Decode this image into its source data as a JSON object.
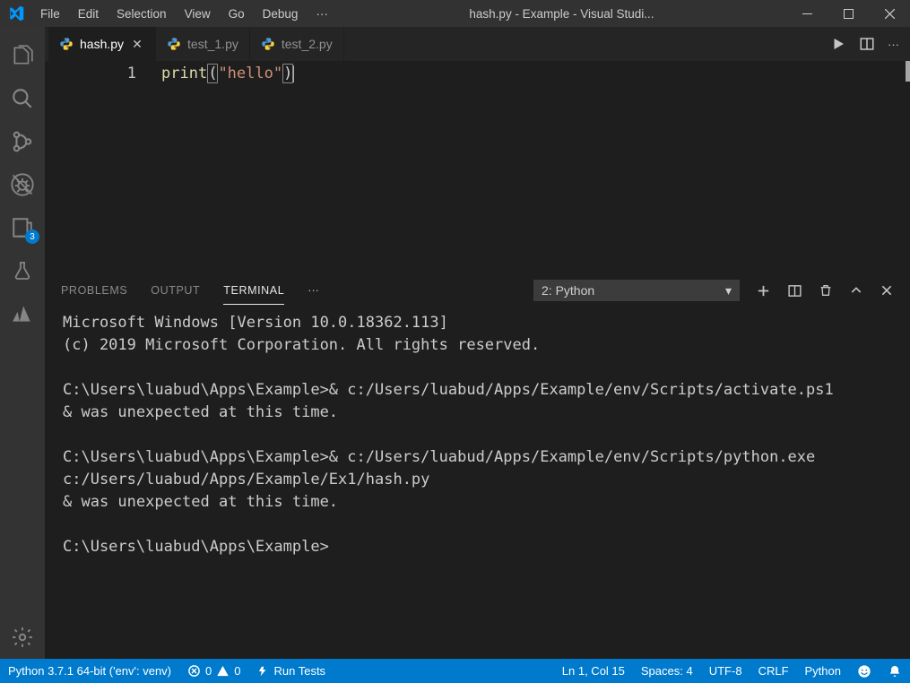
{
  "titlebar": {
    "menu": [
      "File",
      "Edit",
      "Selection",
      "View",
      "Go",
      "Debug"
    ],
    "title": "hash.py - Example - Visual Studi..."
  },
  "activitybar": {
    "items": [
      {
        "name": "explorer-icon"
      },
      {
        "name": "search-icon"
      },
      {
        "name": "scm-icon"
      },
      {
        "name": "debug-icon"
      },
      {
        "name": "tests-icon",
        "badge": "3"
      },
      {
        "name": "beaker-icon"
      },
      {
        "name": "azure-icon"
      }
    ],
    "bottom": [
      {
        "name": "gear-icon"
      }
    ]
  },
  "tabs": [
    {
      "label": "hash.py",
      "active": true,
      "closeable": true
    },
    {
      "label": "test_1.py",
      "active": false,
      "closeable": false
    },
    {
      "label": "test_2.py",
      "active": false,
      "closeable": false
    }
  ],
  "editor": {
    "line_number": "1",
    "tokens": {
      "fn": "print",
      "open": "(",
      "str": "\"hello\"",
      "close": ")"
    }
  },
  "panel": {
    "tabs": {
      "problems": "PROBLEMS",
      "output": "OUTPUT",
      "terminal": "TERMINAL"
    },
    "select": "2: Python",
    "terminal_text": "Microsoft Windows [Version 10.0.18362.113]\n(c) 2019 Microsoft Corporation. All rights reserved.\n\nC:\\Users\\luabud\\Apps\\Example>& c:/Users/luabud/Apps/Example/env/Scripts/activate.ps1\n& was unexpected at this time.\n\nC:\\Users\\luabud\\Apps\\Example>& c:/Users/luabud/Apps/Example/env/Scripts/python.exe c:/Users/luabud/Apps/Example/Ex1/hash.py\n& was unexpected at this time.\n\nC:\\Users\\luabud\\Apps\\Example>"
  },
  "statusbar": {
    "python": "Python 3.7.1 64-bit ('env': venv)",
    "errors": "0",
    "warnings": "0",
    "run_tests": "Run Tests",
    "ln_col": "Ln 1, Col 15",
    "spaces": "Spaces: 4",
    "encoding": "UTF-8",
    "eol": "CRLF",
    "lang": "Python"
  },
  "colors": {
    "python_icon": "#4f9cd6",
    "accent": "#007acc"
  }
}
